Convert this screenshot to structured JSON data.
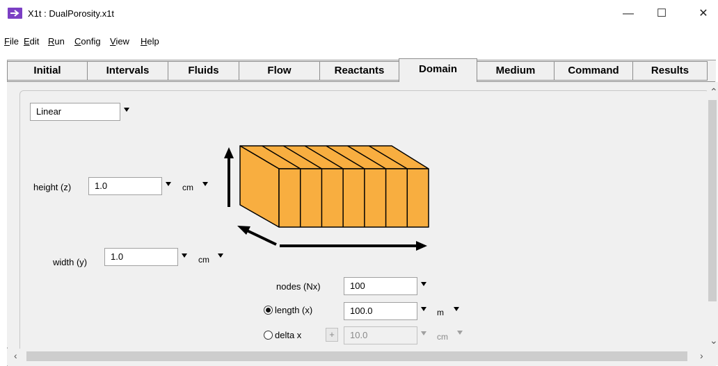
{
  "window": {
    "title": "X1t : DualPorosity.x1t",
    "minimize": "—",
    "maximize": "☐",
    "close": "✕"
  },
  "menu": [
    "File",
    "Edit",
    "Run",
    "Config",
    "View",
    "Help"
  ],
  "tabs": [
    "Initial",
    "Intervals",
    "Fluids",
    "Flow",
    "Reactants",
    "Domain",
    "Medium",
    "Command",
    "Results"
  ],
  "active_tab": "Domain",
  "domain": {
    "geometry": "Linear",
    "height_label": "height (z)",
    "height_value": "1.0",
    "height_unit": "cm",
    "width_label": "width (y)",
    "width_value": "1.0",
    "width_unit": "cm",
    "nodes_label": "nodes (Nx)",
    "nodes_value": "100",
    "length_label": "length (x)",
    "length_value": "100.0",
    "length_unit": "m",
    "deltax_label": "delta x",
    "deltax_plus": "+",
    "deltax_value": "10.0",
    "deltax_unit": "cm",
    "length_selected": true
  },
  "colors": {
    "block_fill": "#f8ae40",
    "block_stroke": "#000000",
    "app_icon": "#7b3fc4"
  }
}
